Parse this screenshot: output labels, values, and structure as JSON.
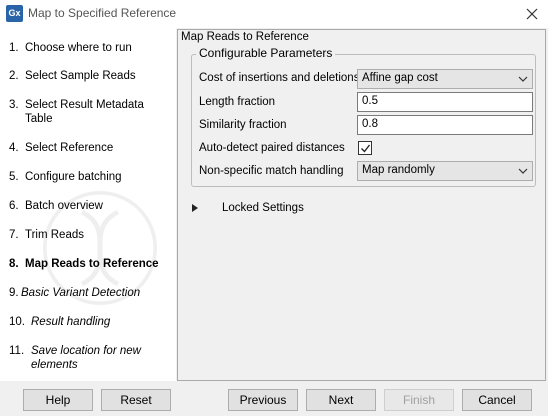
{
  "window": {
    "app_icon_label": "Gx",
    "title": "Map to Specified Reference"
  },
  "steps": [
    {
      "num": "1.",
      "label": "Choose where to run"
    },
    {
      "num": "2.",
      "label": "Select Sample Reads"
    },
    {
      "num": "3.",
      "label": "Select Result Metadata Table"
    },
    {
      "num": "4.",
      "label": "Select Reference"
    },
    {
      "num": "5.",
      "label": "Configure batching"
    },
    {
      "num": "6.",
      "label": "Batch overview"
    },
    {
      "num": "7.",
      "label": "Trim Reads"
    },
    {
      "num": "8.",
      "label": "Map Reads to Reference"
    },
    {
      "num": "9.",
      "label": "Basic Variant Detection"
    },
    {
      "num": "10.",
      "label": "Result handling"
    },
    {
      "num": "11.",
      "label": "Save location for new elements"
    }
  ],
  "active_step": "8.",
  "panel": {
    "title": "Map Reads to Reference",
    "group_title": "Configurable Parameters",
    "params": {
      "cost_label": "Cost of insertions and deletions",
      "cost_value": "Affine gap cost",
      "length_label": "Length fraction",
      "length_value": "0.5",
      "similarity_label": "Similarity fraction",
      "similarity_value": "0.8",
      "autodetect_label": "Auto-detect paired distances",
      "autodetect_checked": true,
      "nonspecific_label": "Non-specific match handling",
      "nonspecific_value": "Map randomly"
    },
    "locked_label": "Locked Settings"
  },
  "buttons": {
    "help": "Help",
    "reset": "Reset",
    "previous": "Previous",
    "next": "Next",
    "finish": "Finish",
    "cancel": "Cancel"
  }
}
